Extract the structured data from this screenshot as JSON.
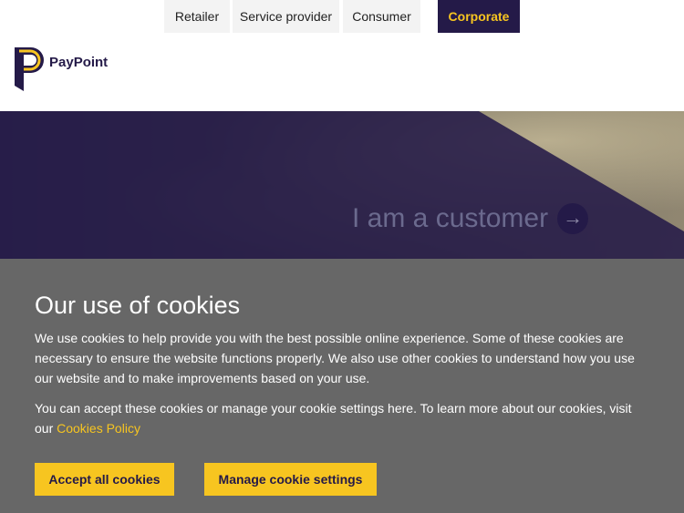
{
  "nav": {
    "tabs": [
      {
        "label": "Retailer"
      },
      {
        "label": "Service provider"
      },
      {
        "label": "Consumer"
      },
      {
        "label": "Corporate",
        "active": true
      }
    ]
  },
  "logo": {
    "text": "PayPoint",
    "icon": "paypoint-p-logo"
  },
  "hero": {
    "cta_label": "I am a customer",
    "cta_icon": "arrow-right-icon"
  },
  "cookies": {
    "title": "Our use of cookies",
    "paragraph1": "We use cookies to help provide you with the best possible online experience. Some of these cookies are necessary to ensure the website functions properly. We also use other cookies to understand how you use our website and to make improvements based on your use.",
    "paragraph2_prefix": "You can accept these cookies or manage your cookie settings here. To learn more about our cookies, visit our ",
    "policy_link": "Cookies Policy",
    "accept_button": "Accept all cookies",
    "manage_button": "Manage cookie settings"
  },
  "colors": {
    "brand_purple": "#241a48",
    "brand_yellow": "#f7c520",
    "panel_grey": "#676767"
  }
}
